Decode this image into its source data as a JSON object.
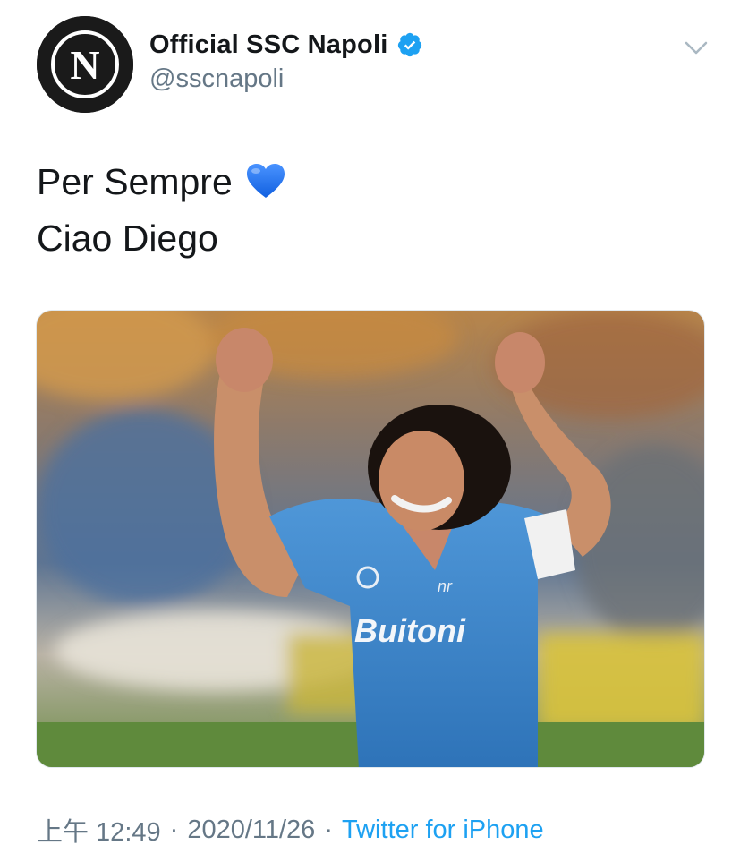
{
  "author": {
    "avatar_letter": "N",
    "display_name": "Official SSC Napoli",
    "handle": "@sscnapoli",
    "verified": true,
    "verified_color": "#1da1f2"
  },
  "tweet": {
    "lines": [
      "Per Sempre",
      "Ciao Diego"
    ],
    "emoji": "blue-heart",
    "media_alt": "photo-player-celebrating-blue-jersey"
  },
  "meta": {
    "time": "上午 12:49",
    "separator": "·",
    "date": "2020/11/26",
    "source": "Twitter for iPhone"
  },
  "colors": {
    "text": "#14171a",
    "secondary": "#657786",
    "link": "#1da1f2",
    "jersey": "#3b82c8"
  },
  "icons": {
    "menu": "chevron-down-icon",
    "verified": "verified-badge-icon",
    "heart": "blue-heart-icon"
  }
}
